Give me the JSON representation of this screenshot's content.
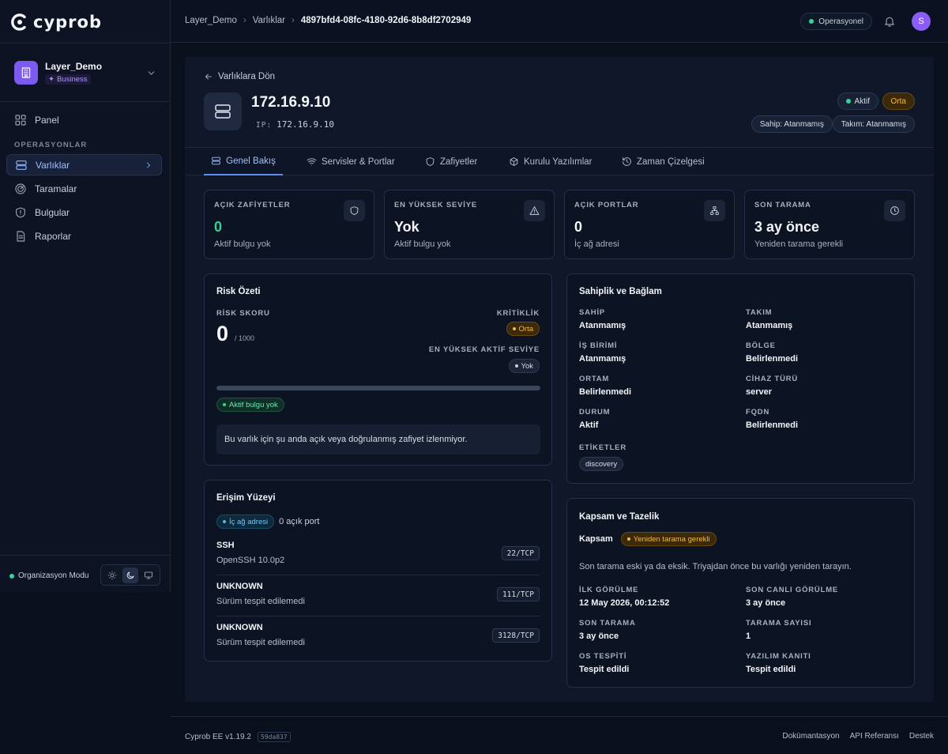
{
  "app": {
    "logo_text": "cyprob"
  },
  "org": {
    "name": "Layer_Demo",
    "plan": "Business"
  },
  "nav": {
    "panel": "Panel",
    "section": "OPERASYONLAR",
    "varliklar": "Varlıklar",
    "taramalar": "Taramalar",
    "bulgular": "Bulgular",
    "raporlar": "Raporlar"
  },
  "sidebar_footer": {
    "mode": "Organizasyon Modu"
  },
  "breadcrumb": [
    "Layer_Demo",
    "Varlıklar",
    "4897bfd4-08fc-4180-92d6-8b8df2702949"
  ],
  "topbar": {
    "status": "Operasyonel",
    "avatar": "S"
  },
  "asset": {
    "back": "Varlıklara Dön",
    "title": "172.16.9.10",
    "ip_label": "IP:",
    "ip": "172.16.9.10",
    "status": "Aktif",
    "criticality": "Orta",
    "owner": "Sahip: Atanmamış",
    "team": "Takım: Atanmamış"
  },
  "tabs": [
    "Genel Bakış",
    "Servisler & Portlar",
    "Zafiyetler",
    "Kurulu Yazılımlar",
    "Zaman Çizelgesi"
  ],
  "stats": [
    {
      "label": "AÇIK ZAFİYETLER",
      "value": "0",
      "sub": "Aktif bulgu yok"
    },
    {
      "label": "EN YÜKSEK SEVİYE",
      "value": "Yok",
      "sub": "Aktif bulgu yok"
    },
    {
      "label": "AÇIK PORTLAR",
      "value": "0",
      "sub": "İç ağ adresi"
    },
    {
      "label": "SON TARAMA",
      "value": "3 ay önce",
      "sub": "Yeniden tarama gerekli"
    }
  ],
  "risk": {
    "title": "Risk Özeti",
    "score_label": "RİSK SKORU",
    "score": "0",
    "score_max": "/ 1000",
    "score_fraction": 0,
    "crit_label": "KRİTİKLİK",
    "crit": "Orta",
    "top_label": "EN YÜKSEK AKTİF SEVİYE",
    "top": "Yok",
    "badge": "Aktif bulgu yok",
    "note": "Bu varlık için şu anda açık veya doğrulanmış zafiyet izlenmiyor."
  },
  "surface": {
    "title": "Erişim Yüzeyi",
    "badge": "İç ağ adresi",
    "count": "0 açık port",
    "ports": [
      {
        "name": "SSH",
        "version": "OpenSSH 10.0p2",
        "port": "22/TCP"
      },
      {
        "name": "UNKNOWN",
        "version": "Sürüm tespit edilemedi",
        "port": "111/TCP"
      },
      {
        "name": "UNKNOWN",
        "version": "Sürüm tespit edilemedi",
        "port": "3128/TCP"
      }
    ]
  },
  "ownership": {
    "title": "Sahiplik ve Bağlam",
    "fields": [
      {
        "label": "SAHİP",
        "value": "Atanmamış"
      },
      {
        "label": "TAKIM",
        "value": "Atanmamış"
      },
      {
        "label": "İŞ BİRİMİ",
        "value": "Atanmamış"
      },
      {
        "label": "BÖLGE",
        "value": "Belirlenmedi"
      },
      {
        "label": "ORTAM",
        "value": "Belirlenmedi"
      },
      {
        "label": "CİHAZ TÜRÜ",
        "value": "server"
      },
      {
        "label": "DURUM",
        "value": "Aktif"
      },
      {
        "label": "FQDN",
        "value": "Belirlenmedi"
      }
    ],
    "tags_label": "ETİKETLER",
    "tag": "discovery"
  },
  "coverage": {
    "title": "Kapsam ve Tazelik",
    "label": "Kapsam",
    "badge": "Yeniden tarama gerekli",
    "note": "Son tarama eski ya da eksik. Triyajdan önce bu varlığı yeniden tarayın.",
    "fields": [
      {
        "label": "İLK GÖRÜLME",
        "value": "12 May 2026, 00:12:52"
      },
      {
        "label": "SON CANLI GÖRÜLME",
        "value": "3 ay önce"
      },
      {
        "label": "SON TARAMA",
        "value": "3 ay önce"
      },
      {
        "label": "TARAMA SAYISI",
        "value": "1"
      },
      {
        "label": "OS TESPİTİ",
        "value": "Tespit edildi"
      },
      {
        "label": "YAZILIM KANITI",
        "value": "Tespit edildi"
      }
    ]
  },
  "footer": {
    "version": "Cyprob EE v1.19.2",
    "hash": "59da837",
    "links": [
      "Dokümantasyon",
      "API Referansı",
      "Destek"
    ]
  },
  "colors": {
    "accent": "#5b8ef5",
    "success": "#34d399",
    "warning": "#f5b94a",
    "brand": "#7c5cf0"
  }
}
